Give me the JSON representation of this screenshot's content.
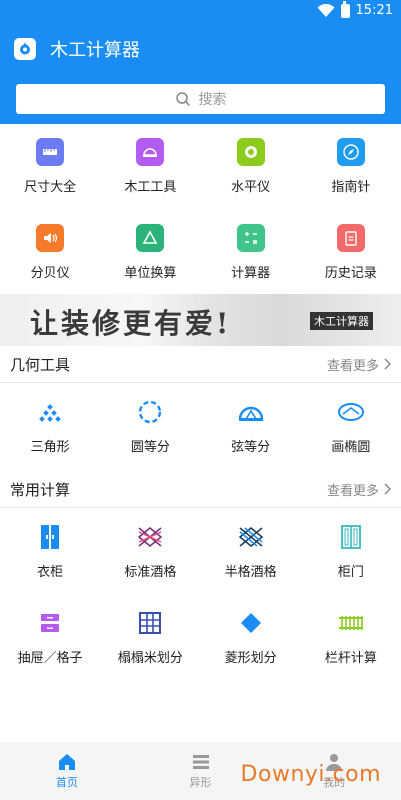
{
  "status": {
    "time": "15:21"
  },
  "app": {
    "title": "木工计算器"
  },
  "search": {
    "placeholder": "搜索"
  },
  "tools_row1": [
    {
      "label": "尺寸大全",
      "icon": "ruler-icon",
      "color": "#6b7cf2"
    },
    {
      "label": "木工工具",
      "icon": "toolbox-icon",
      "color": "#b45bf0"
    },
    {
      "label": "水平仪",
      "icon": "level-icon",
      "color": "#8ccc1e"
    },
    {
      "label": "指南针",
      "icon": "compass-icon",
      "color": "#1f9cf0"
    }
  ],
  "tools_row2": [
    {
      "label": "分贝仪",
      "icon": "speaker-icon",
      "color": "#f57a2a"
    },
    {
      "label": "单位换算",
      "icon": "triangle-recycle-icon",
      "color": "#2bb37a"
    },
    {
      "label": "计算器",
      "icon": "calculator-icon",
      "color": "#3fc58a"
    },
    {
      "label": "历史记录",
      "icon": "clipboard-icon",
      "color": "#f26a6a"
    }
  ],
  "banner": {
    "slogan": "让装修更有爱!",
    "tag": "木工计算器"
  },
  "geometry": {
    "title": "几何工具",
    "more": "查看更多",
    "items": [
      {
        "label": "三角形",
        "icon": "triangle-icon"
      },
      {
        "label": "圆等分",
        "icon": "circle-divide-icon"
      },
      {
        "label": "弦等分",
        "icon": "chord-icon"
      },
      {
        "label": "画椭圆",
        "icon": "ellipse-icon"
      }
    ]
  },
  "common": {
    "title": "常用计算",
    "more": "查看更多",
    "row1": [
      {
        "label": "衣柜",
        "icon": "wardrobe-icon"
      },
      {
        "label": "标准酒格",
        "icon": "wine-rack-icon"
      },
      {
        "label": "半格酒格",
        "icon": "half-wine-rack-icon"
      },
      {
        "label": "柜门",
        "icon": "cabinet-door-icon"
      }
    ],
    "row2": [
      {
        "label": "抽屉／格子",
        "icon": "drawer-icon"
      },
      {
        "label": "榻榻米划分",
        "icon": "tatami-icon"
      },
      {
        "label": "菱形划分",
        "icon": "diamond-icon"
      },
      {
        "label": "栏杆计算",
        "icon": "railing-icon"
      }
    ]
  },
  "tabs": [
    {
      "label": "首页",
      "icon": "home-icon"
    },
    {
      "label": "异形",
      "icon": "list-icon"
    },
    {
      "label": "我的",
      "icon": "user-icon"
    }
  ],
  "watermark": "Downyi.com",
  "colors": {
    "primary": "#1a8df5"
  }
}
